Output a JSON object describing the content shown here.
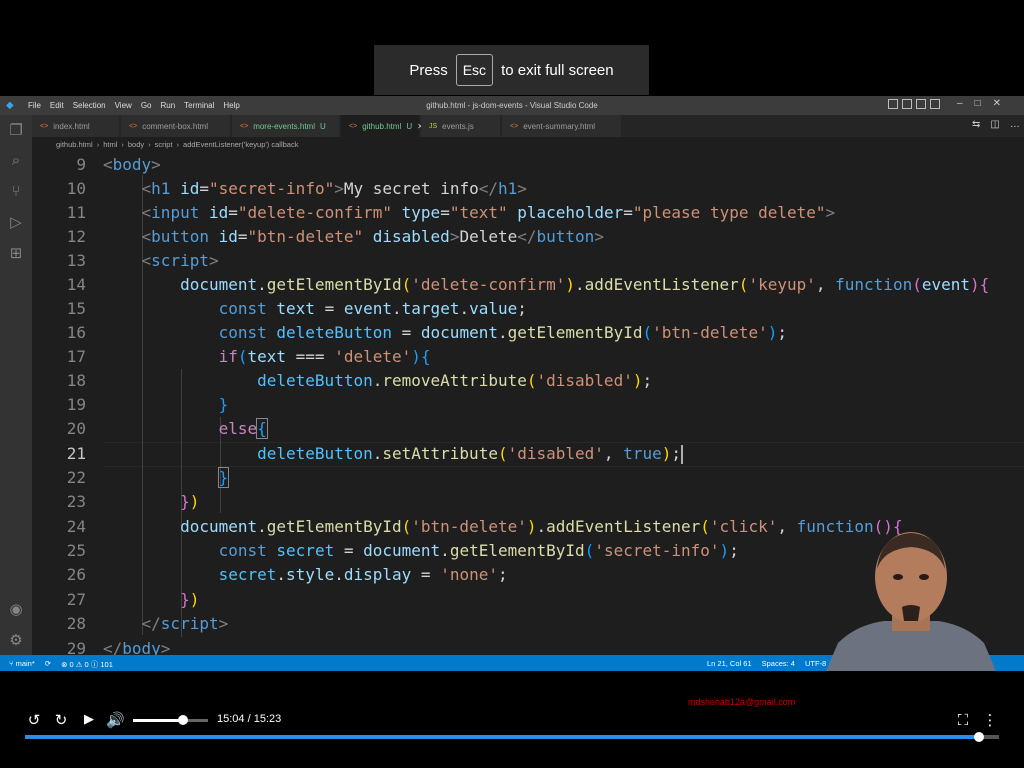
{
  "fullscreen_hint": {
    "pre": "Press",
    "key": "Esc",
    "post": "to exit full screen"
  },
  "vscode": {
    "menu": [
      "File",
      "Edit",
      "Selection",
      "View",
      "Go",
      "Run",
      "Terminal",
      "Help"
    ],
    "title": "github.html - js-dom-events - Visual Studio Code",
    "tabs": [
      {
        "label": "index.html",
        "badge": "",
        "active": false
      },
      {
        "label": "comment-box.html",
        "badge": "",
        "active": false
      },
      {
        "label": "more-events.html",
        "badge": "U",
        "active": false
      },
      {
        "label": "github.html",
        "badge": "U",
        "active": true
      },
      {
        "label": "events.js",
        "badge": "",
        "active": false
      },
      {
        "label": "event-summary.html",
        "badge": "",
        "active": false
      }
    ],
    "breadcrumb": [
      "github.html",
      "html",
      "body",
      "script",
      "addEventListener('keyup') callback"
    ],
    "line_numbers": [
      "9",
      "10",
      "11",
      "12",
      "13",
      "14",
      "15",
      "16",
      "17",
      "18",
      "19",
      "20",
      "21",
      "22",
      "23",
      "24",
      "25",
      "26",
      "27",
      "28",
      "29"
    ],
    "status": {
      "branch": "main*",
      "problems": "0",
      "warnings": "0",
      "info": "101",
      "position": "Ln 21, Col 61",
      "spaces": "Spaces: 4",
      "encoding": "UTF-8"
    }
  },
  "player": {
    "time": "15:04 / 15:23",
    "email": "mdshehab12a@gmail.com",
    "volume": 0.67,
    "progress": 0.979
  }
}
